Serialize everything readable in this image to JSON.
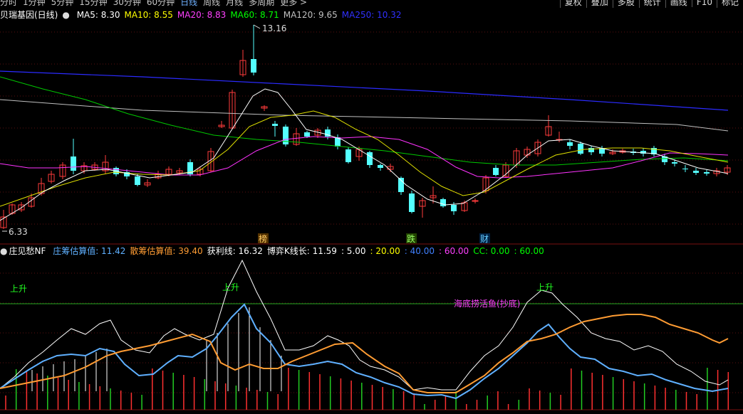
{
  "toolbar": {
    "tabs": [
      "分时",
      "1分钟",
      "5分钟",
      "15分钟",
      "30分钟",
      "60分钟",
      "日线",
      "周线",
      "月线",
      "多周期",
      "更多 >"
    ],
    "active_tab": "日线",
    "right_buttons": [
      "复权",
      "叠加",
      "多股",
      "统计",
      "画线",
      "F10",
      "标记"
    ]
  },
  "main_chart": {
    "title": "贝瑞基因(日线)",
    "ma_labels": [
      {
        "text": "MA5: 8.30",
        "color": "#ffffff"
      },
      {
        "text": "MA10: 8.55",
        "color": "#ffff00"
      },
      {
        "text": "MA20: 8.83",
        "color": "#ff40ff"
      },
      {
        "text": "MA60: 8.71",
        "color": "#00ff00"
      },
      {
        "text": "MA120: 9.65",
        "color": "#c0c0c0"
      },
      {
        "text": "MA250: 10.32",
        "color": "#3030ff"
      }
    ],
    "high_label": "13.16",
    "low_label": "6.33",
    "markers": [
      {
        "text": "榜",
        "color": "#ffcc66",
        "bg": "#553300"
      },
      {
        "text": "跌",
        "color": "#99ff66",
        "bg": "#224400"
      },
      {
        "text": "财",
        "color": "#66ccff",
        "bg": "#002244"
      }
    ],
    "colors": {
      "up": "#ff3b3b",
      "down": "#54ffff"
    }
  },
  "sub_chart": {
    "title": "庄见愁NF",
    "labels": [
      {
        "text": "庄筹估算值: 11.42",
        "color": "#5fb0ff"
      },
      {
        "text": "散筹估算值: 39.40",
        "color": "#ff9c33"
      },
      {
        "text": "获利线: 16.32",
        "color": "#ffffff"
      },
      {
        "text": "博弈K线长: 11.59",
        "color": "#ffffff"
      },
      {
        "text": ": 5.00",
        "color": "#ffffff"
      },
      {
        "text": ": 20.00",
        "color": "#ffff00"
      },
      {
        "text": ": 40.00",
        "color": "#4080ff"
      },
      {
        "text": ": 60.00",
        "color": "#ff40ff"
      },
      {
        "text": "CC: 0.00",
        "color": "#00ff00"
      },
      {
        "text": ": 60.00",
        "color": "#00ff00"
      }
    ],
    "annotations": [
      {
        "text": "上升",
        "color": "#22ff22"
      },
      {
        "text": "上升",
        "color": "#22ff22"
      },
      {
        "text": "上升",
        "color": "#22ff22"
      },
      {
        "text": "海底捞活鱼(抄底)",
        "color": "#ff44ff"
      }
    ]
  }
}
